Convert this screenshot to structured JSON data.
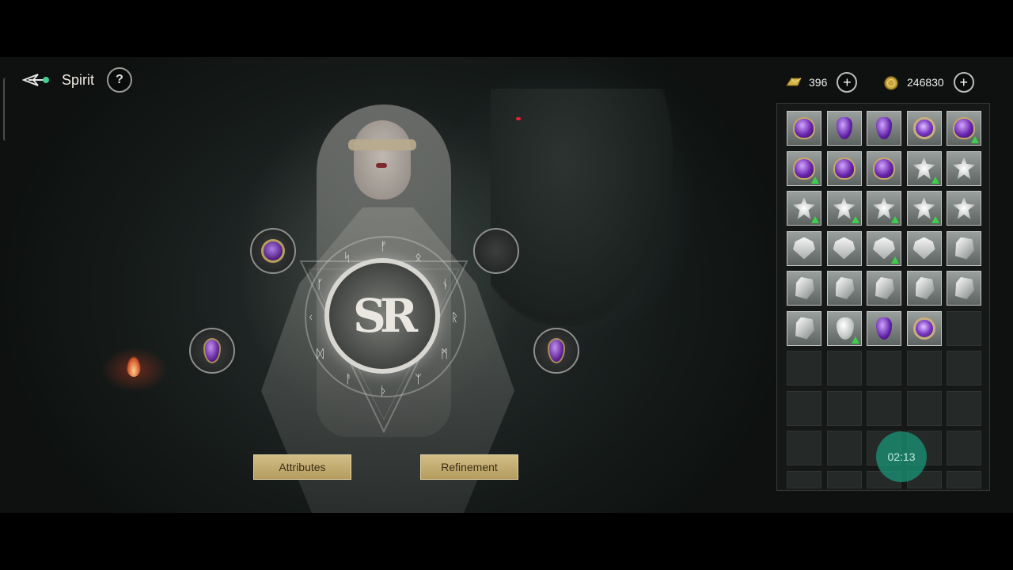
{
  "header": {
    "title": "Spirit",
    "help_label": "?"
  },
  "currencies": [
    {
      "icon": "gold-ingot-icon",
      "value": "396",
      "plus_label": "+"
    },
    {
      "icon": "gold-coin-icon",
      "value": "246830",
      "plus_label": "+"
    }
  ],
  "emblem": {
    "glyph": "SR",
    "runes": [
      "ᚠ",
      "ᛟ",
      "ᚾ",
      "ᚱ",
      "ᛗ",
      "ᛉ",
      "ᚦ",
      "ᚨ",
      "ᛞ",
      "ᚲ",
      "ᚴ",
      "ᛋ"
    ]
  },
  "sockets": [
    {
      "name": "socket-top-left",
      "item": "purple-ring-gem"
    },
    {
      "name": "socket-top-right",
      "item": "empty"
    },
    {
      "name": "socket-left",
      "item": "purple-drop-gem"
    },
    {
      "name": "socket-right",
      "item": "purple-drop-gem"
    }
  ],
  "buttons": {
    "attributes": "Attributes",
    "refinement": "Refinement"
  },
  "inventory": {
    "columns": 5,
    "rows": 10,
    "items": [
      {
        "type": "purple-gem",
        "upgrade": false
      },
      {
        "type": "purple-drop",
        "upgrade": false
      },
      {
        "type": "purple-drop",
        "upgrade": false
      },
      {
        "type": "purple-round",
        "upgrade": false
      },
      {
        "type": "purple-gem",
        "upgrade": true
      },
      {
        "type": "purple-gem",
        "upgrade": true
      },
      {
        "type": "purple-gem",
        "upgrade": false
      },
      {
        "type": "purple-gem",
        "upgrade": false
      },
      {
        "type": "silver-star",
        "upgrade": true
      },
      {
        "type": "silver-star",
        "upgrade": false
      },
      {
        "type": "silver-star",
        "upgrade": true
      },
      {
        "type": "silver-star",
        "upgrade": true
      },
      {
        "type": "silver-star",
        "upgrade": true
      },
      {
        "type": "silver-star",
        "upgrade": true
      },
      {
        "type": "silver-star",
        "upgrade": false
      },
      {
        "type": "silver-crest",
        "upgrade": false
      },
      {
        "type": "silver-crest",
        "upgrade": false
      },
      {
        "type": "silver-crest",
        "upgrade": true
      },
      {
        "type": "silver-crest",
        "upgrade": false
      },
      {
        "type": "silver-crystal",
        "upgrade": false
      },
      {
        "type": "silver-crystal",
        "upgrade": false
      },
      {
        "type": "silver-crystal",
        "upgrade": false
      },
      {
        "type": "silver-crystal",
        "upgrade": false
      },
      {
        "type": "silver-crystal",
        "upgrade": false
      },
      {
        "type": "silver-crystal",
        "upgrade": false
      },
      {
        "type": "silver-crystal",
        "upgrade": false
      },
      {
        "type": "silver-drop",
        "upgrade": true
      },
      {
        "type": "purple-drop",
        "upgrade": false
      },
      {
        "type": "purple-round",
        "upgrade": false
      }
    ]
  },
  "timer": {
    "value": "02:13"
  },
  "colors": {
    "accent_gold": "#c9b277",
    "gem_purple": "#6a25ad",
    "upgrade_green": "#3bd24a",
    "timer_teal": "#1a9678"
  }
}
